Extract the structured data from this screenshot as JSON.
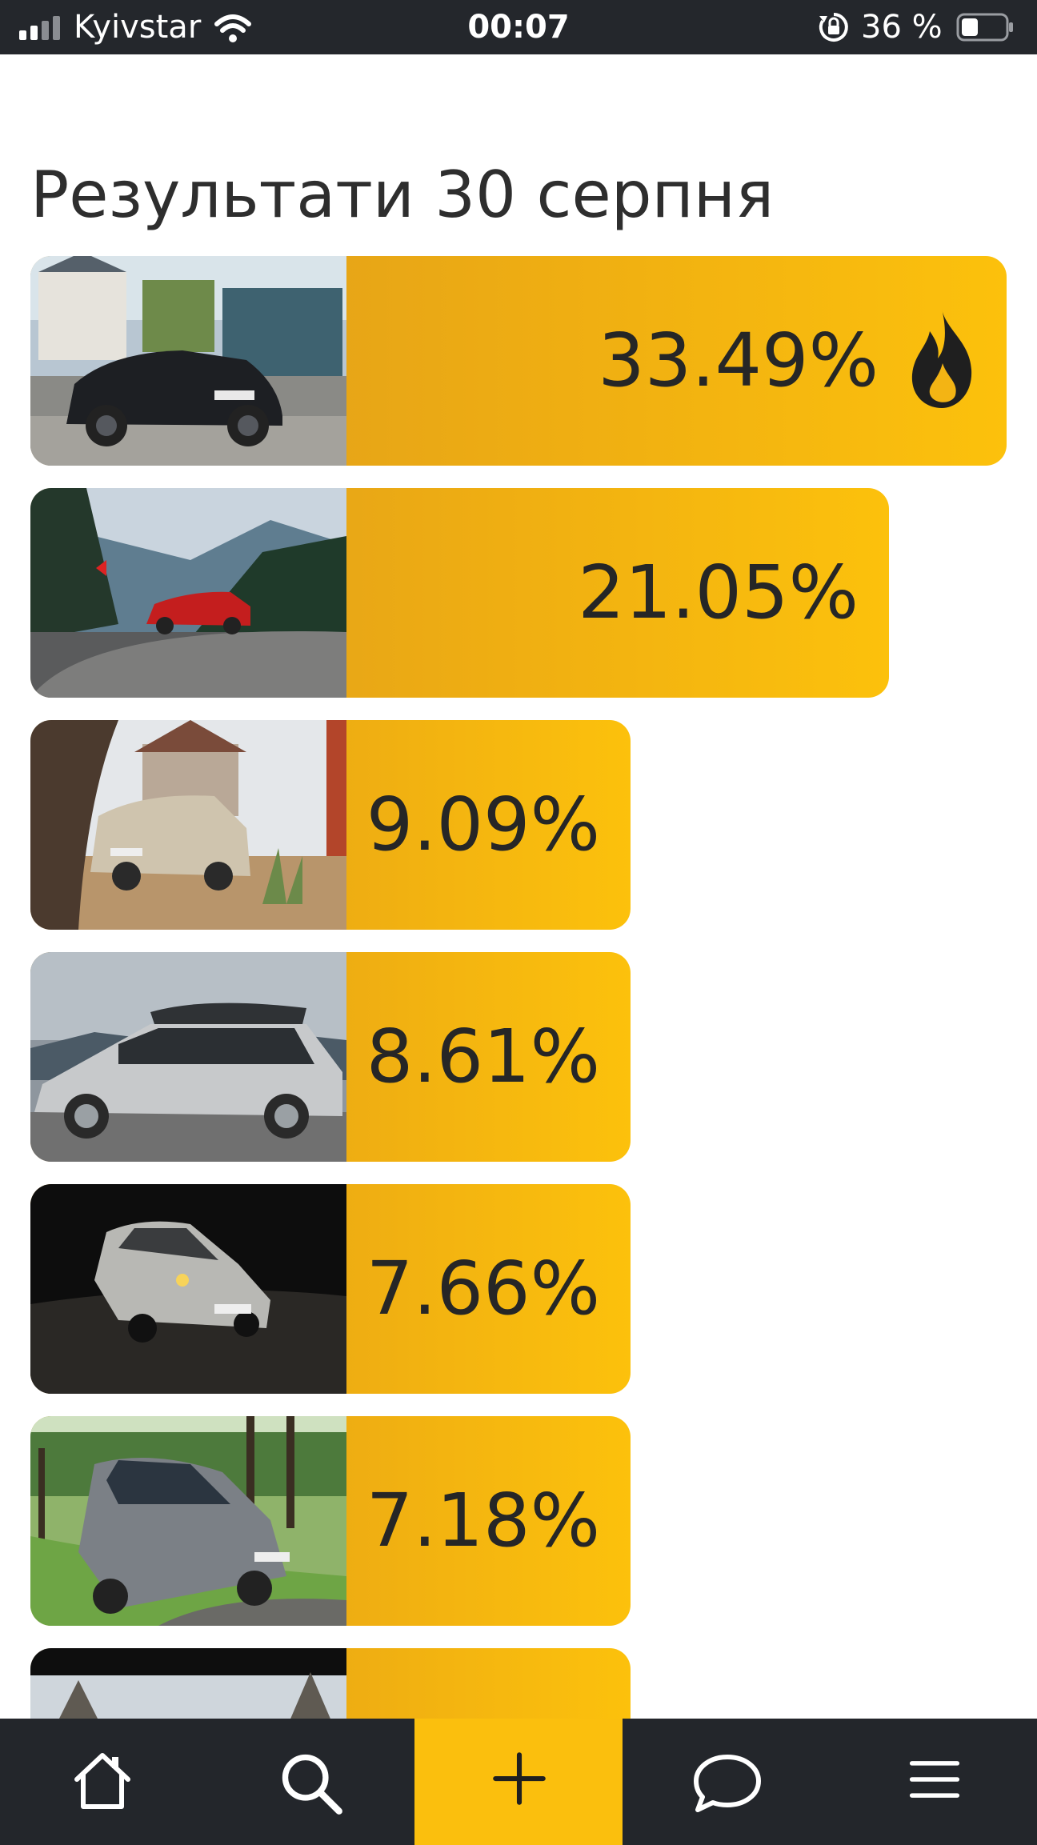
{
  "status_bar": {
    "carrier": "Kyivstar",
    "time": "00:07",
    "battery": "36 %"
  },
  "page": {
    "title": "Результати 30 серпня"
  },
  "results": [
    {
      "percent": "33.49%",
      "fill_fraction": 1.0,
      "hot": true,
      "photo": "black BMW X4 on a cobbled street"
    },
    {
      "percent": "21.05%",
      "fill_fraction": 0.81,
      "hot": false,
      "photo": "red sedan on a mountain road"
    },
    {
      "percent": "9.09%",
      "fill_fraction": 0.63,
      "hot": false,
      "photo": "beige Alfa Romeo beside a fence"
    },
    {
      "percent": "8.61%",
      "fill_fraction": 0.63,
      "hot": false,
      "photo": "silver Skoda wagon with roof box"
    },
    {
      "percent": "7.66%",
      "fill_fraction": 0.63,
      "hot": false,
      "photo": "silver hatchback at night"
    },
    {
      "percent": "7.18%",
      "fill_fraction": 0.63,
      "hot": false,
      "photo": "grey VW Tiguan on grass"
    },
    {
      "percent": "",
      "fill_fraction": 0.63,
      "hot": false,
      "photo": "partially visible car photo"
    }
  ],
  "nav": {
    "items": [
      "home-icon",
      "search-icon",
      "plus-icon",
      "chat-icon",
      "menu-icon"
    ],
    "accent": "#fbbf0d",
    "background": "#23262b"
  },
  "colors": {
    "bar_start": "#dc9a1e",
    "bar_end": "#fcc10c",
    "status_bar": "#24272c"
  }
}
